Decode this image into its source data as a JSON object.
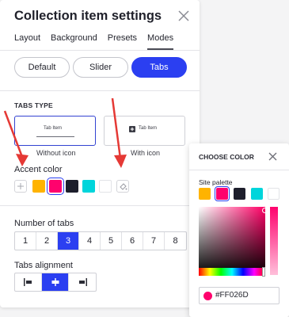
{
  "panel": {
    "title": "Collection item settings",
    "tabs": [
      {
        "label": "Layout",
        "active": false
      },
      {
        "label": "Background",
        "active": false
      },
      {
        "label": "Presets",
        "active": false
      },
      {
        "label": "Modes",
        "active": true
      }
    ],
    "modes": [
      {
        "label": "Default",
        "active": false
      },
      {
        "label": "Slider",
        "active": false
      },
      {
        "label": "Tabs",
        "active": true
      }
    ],
    "tabs_type": {
      "heading": "TABS TYPE",
      "options": [
        {
          "caption": "Without icon",
          "item_label": "Tab Item",
          "active": true
        },
        {
          "caption": "With icon",
          "item_label": "Tab Item",
          "active": false
        }
      ]
    },
    "accent": {
      "label": "Accent color",
      "swatches": [
        "#FFB300",
        "#FF026D",
        "#1D1E2C",
        "#00D5DB",
        "#FFFFFF"
      ],
      "selected": "#FF026D"
    },
    "number_of_tabs": {
      "label": "Number of tabs",
      "options": [
        "1",
        "2",
        "3",
        "4",
        "5",
        "6",
        "7",
        "8"
      ],
      "selected": "3"
    },
    "alignment": {
      "label": "Tabs alignment",
      "options": [
        {
          "icon": "align-left-icon",
          "active": false
        },
        {
          "icon": "align-center-icon",
          "active": true
        },
        {
          "icon": "align-right-icon",
          "active": false
        }
      ]
    }
  },
  "color_popover": {
    "title": "CHOOSE COLOR",
    "site_palette_label": "Site palette",
    "swatches": [
      "#FFB300",
      "#FF026D",
      "#1D1E2C",
      "#00D5DB",
      "#FFFFFF"
    ],
    "selected": "#FF026D",
    "hex_value": "#FF026D"
  },
  "annotations": {
    "arrow_color": "#E53935"
  }
}
